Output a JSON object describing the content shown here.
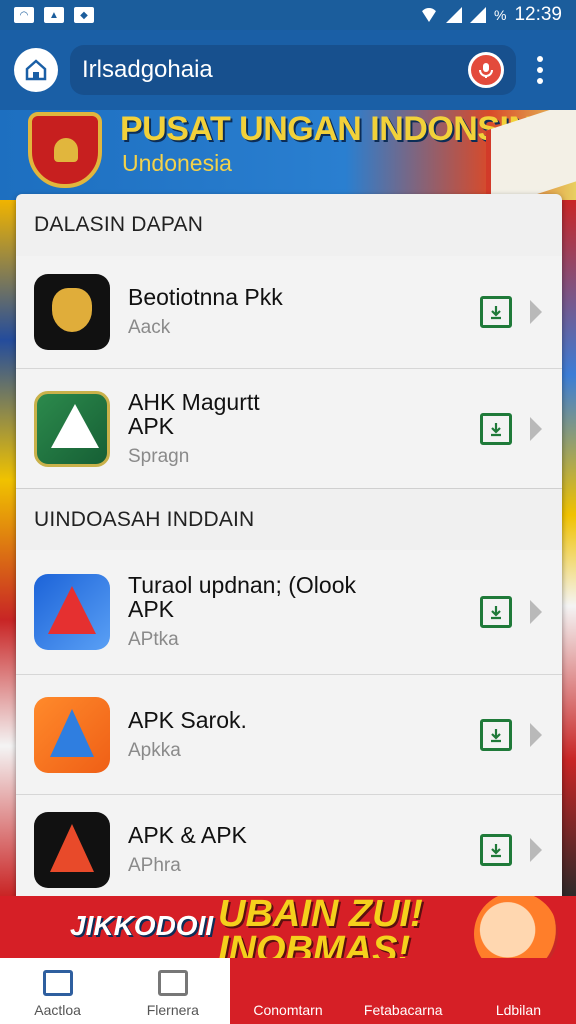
{
  "status_bar": {
    "time": "12:39",
    "battery": "%"
  },
  "app_bar": {
    "search_value": "Irlsadgohaia"
  },
  "banner": {
    "title": "PUSAT UNGAN INDONSIN",
    "subtitle": "Undonesia"
  },
  "sections": [
    {
      "header": "DALASIN DAPAN",
      "apps": [
        {
          "name": "Beotiotnna Pkk",
          "sub": "Aack"
        },
        {
          "name": "AHK Magurtt\nAPK",
          "sub": "Spragn"
        }
      ]
    },
    {
      "header": "UINDOASAH INDDAIN",
      "apps": [
        {
          "name": "Turaol updnan; (Olook\nAPK",
          "sub": "APtka"
        },
        {
          "name": "APK Sarok.",
          "sub": "Apkka"
        },
        {
          "name": "APK & APK",
          "sub": "APhra"
        }
      ]
    }
  ],
  "promo": {
    "left_text": "JIKKODOII",
    "right_text": "UBAIN ZUI!\nINOBMAS!"
  },
  "bottom_nav": [
    {
      "label": "Aactloa"
    },
    {
      "label": "Flernera"
    },
    {
      "label": "Conomtarn"
    },
    {
      "label": "Fetabacarna"
    },
    {
      "label": "Ldbilan"
    }
  ],
  "colors": {
    "app_bar": "#1a5fa6",
    "accent_red": "#d61f26",
    "download_green": "#1f7a39"
  }
}
